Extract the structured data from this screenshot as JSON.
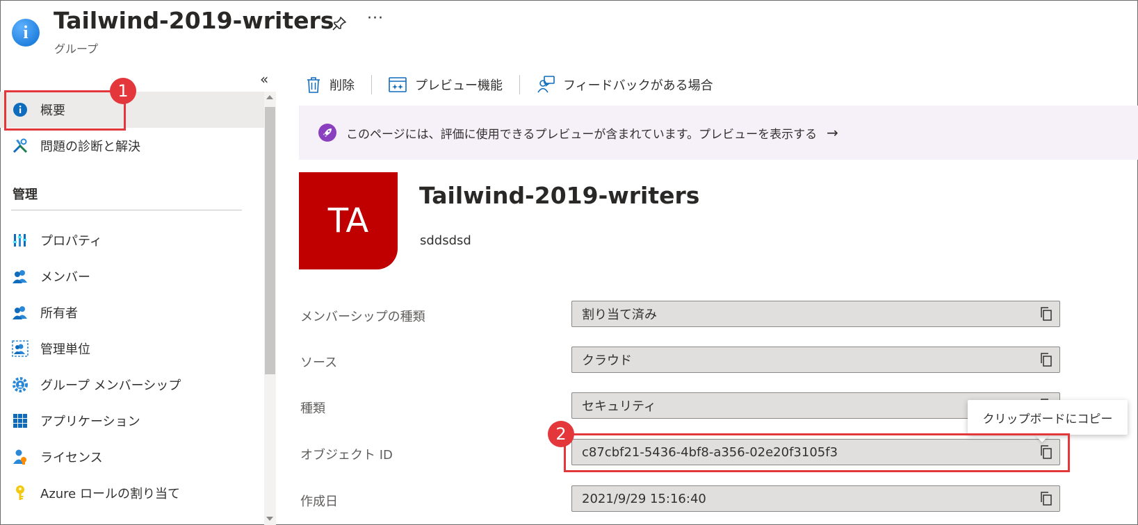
{
  "header": {
    "title": "Tailwind-2019-writers",
    "subtitle": "グループ",
    "more_label": "···"
  },
  "sidebar": {
    "collapse_label": "«",
    "items": [
      {
        "label": "概要",
        "icon": "info-icon",
        "active": true
      },
      {
        "label": "問題の診断と解決",
        "icon": "wrench-icon"
      }
    ],
    "section_title": "管理",
    "manage_items": [
      {
        "label": "プロパティ",
        "icon": "properties-icon"
      },
      {
        "label": "メンバー",
        "icon": "members-icon"
      },
      {
        "label": "所有者",
        "icon": "owners-icon"
      },
      {
        "label": "管理単位",
        "icon": "admin-units-icon"
      },
      {
        "label": "グループ メンバーシップ",
        "icon": "gear-icon"
      },
      {
        "label": "アプリケーション",
        "icon": "grid-icon"
      },
      {
        "label": "ライセンス",
        "icon": "license-icon"
      },
      {
        "label": "Azure ロールの割り当て",
        "icon": "key-icon"
      }
    ]
  },
  "toolbar": {
    "delete_label": "削除",
    "preview_label": "プレビュー機能",
    "feedback_label": "フィードバックがある場合"
  },
  "banner": {
    "text": "このページには、評価に使用できるプレビューが含まれています。プレビューを表示する",
    "arrow": "→"
  },
  "group": {
    "initials": "TA",
    "name": "Tailwind-2019-writers",
    "description": "sddsdsd",
    "avatar_color": "#c00000"
  },
  "properties": [
    {
      "label": "メンバーシップの種類",
      "value": "割り当て済み"
    },
    {
      "label": "ソース",
      "value": "クラウド"
    },
    {
      "label": "種類",
      "value": "セキュリティ"
    },
    {
      "label": "オブジェクト ID",
      "value": "c87cbf21-5436-4bf8-a356-02e20f3105f3"
    },
    {
      "label": "作成日",
      "value": "2021/9/29 15:16:40"
    }
  ],
  "tooltip": {
    "text": "クリップボードにコピー"
  },
  "annotations": {
    "badge1": "1",
    "badge2": "2",
    "highlight_color": "#e3373c"
  }
}
